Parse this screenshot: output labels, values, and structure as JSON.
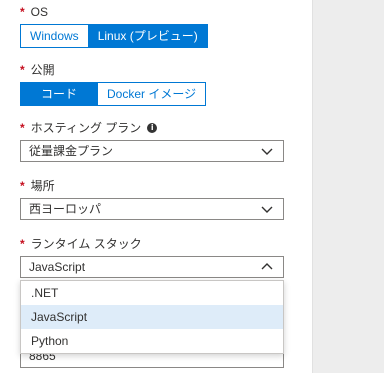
{
  "os": {
    "label": "OS",
    "options": [
      "Windows",
      "Linux (プレビュー)"
    ],
    "selected": "Linux (プレビュー)"
  },
  "publish": {
    "label": "公開",
    "options": [
      "コード",
      "Docker イメージ"
    ],
    "selected": "コード"
  },
  "hosting_plan": {
    "label": "ホスティング プラン",
    "value": "従量課金プラン"
  },
  "location": {
    "label": "場所",
    "value": "西ヨーロッパ"
  },
  "runtime_stack": {
    "label": "ランタイム スタック",
    "value": "JavaScript",
    "options": [
      ".NET",
      "JavaScript",
      "Python"
    ]
  },
  "partial_field": {
    "value": "8865"
  },
  "colors": {
    "accent": "#0078d4",
    "required": "#c50f1f",
    "highlight": "#deecf9",
    "side_panel": "#ededed"
  },
  "icons": {
    "info": "info-icon",
    "chevron_down": "chevron-down-icon",
    "chevron_up": "chevron-up-icon"
  }
}
